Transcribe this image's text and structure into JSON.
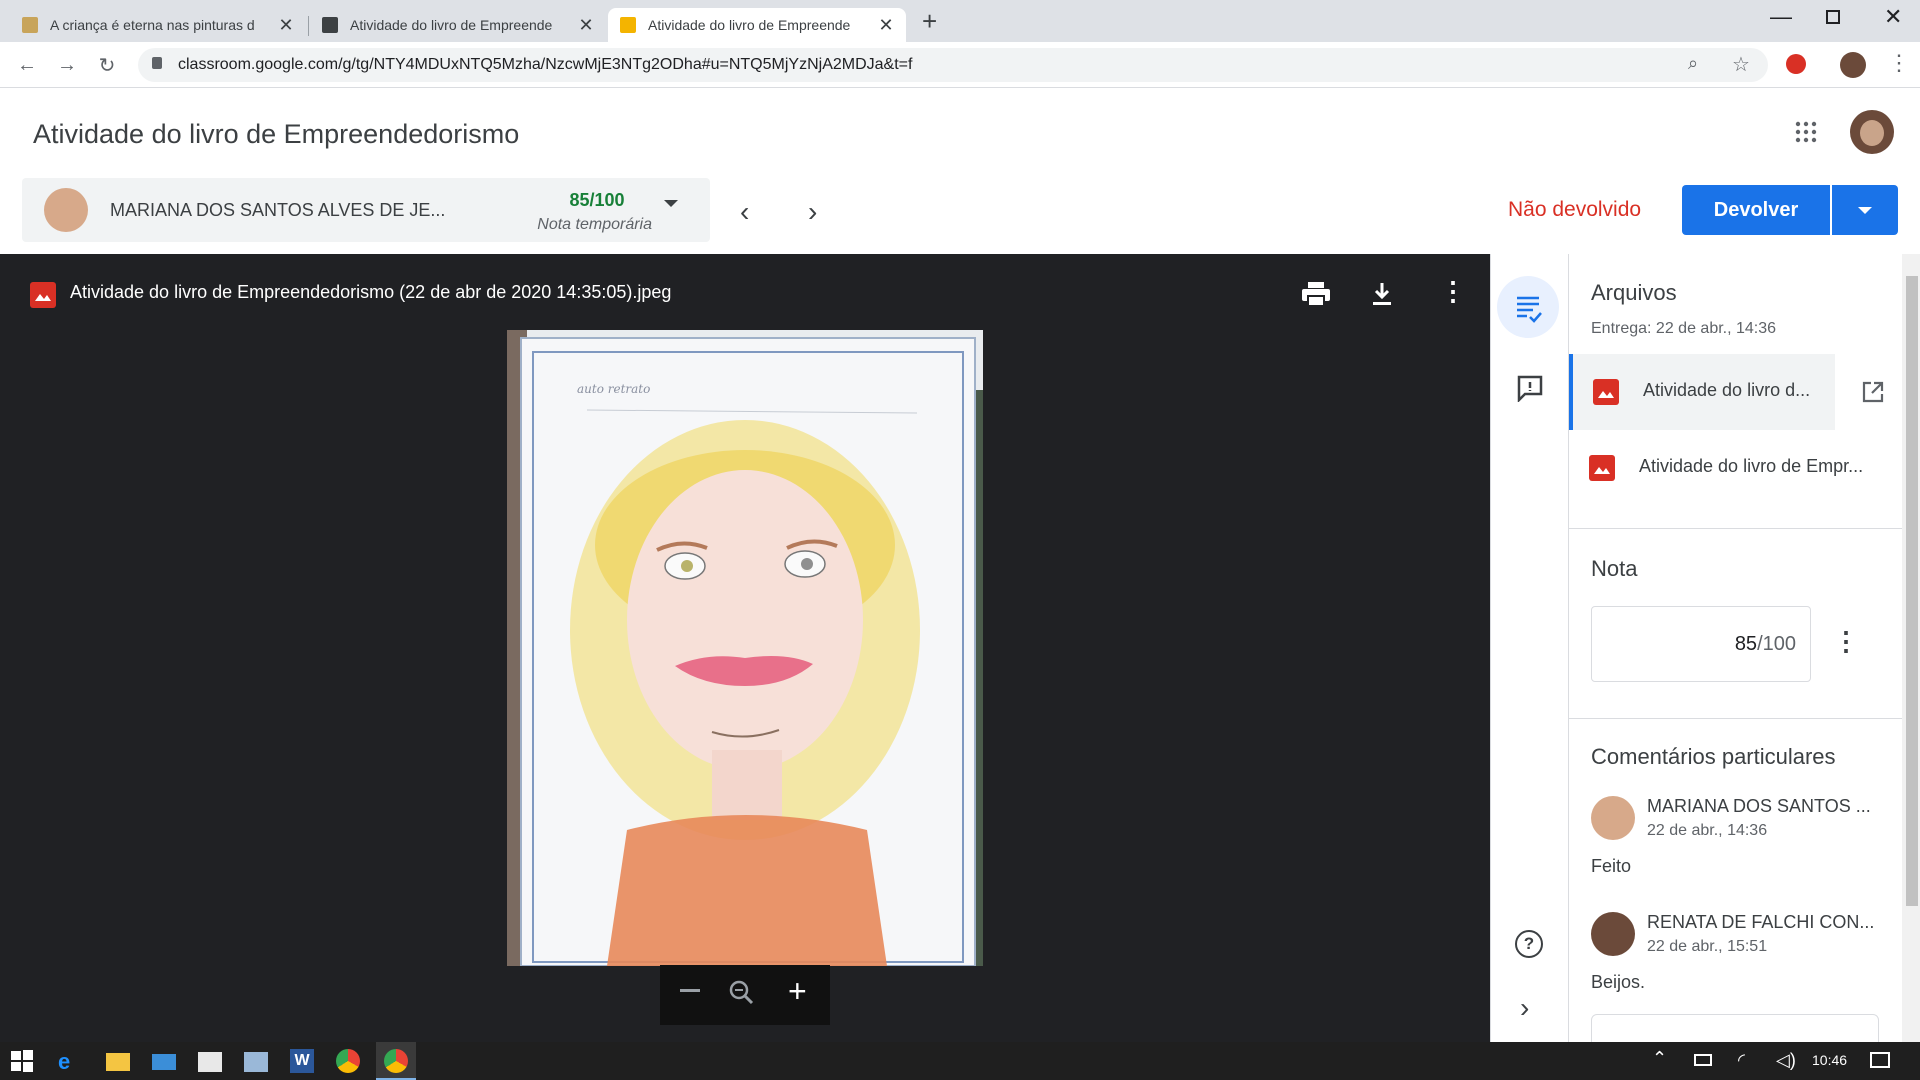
{
  "browser": {
    "tabs": [
      {
        "title": "A criança é eterna nas pinturas d",
        "active": false
      },
      {
        "title": "Atividade do livro de Empreende",
        "active": false
      },
      {
        "title": "Atividade do livro de Empreende",
        "active": true
      }
    ],
    "url": "classroom.google.com/g/tg/NTY4MDUxNTQ5Mzha/NzcwMjE3NTg2ODha#u=NTQ5MjYzNjA2MDJa&t=f"
  },
  "header": {
    "title": "Atividade do livro de Empreendedorismo"
  },
  "student": {
    "name": "MARIANA DOS SANTOS ALVES DE JE...",
    "grade": "85/100",
    "grade_note": "Nota temporária"
  },
  "status": {
    "label": "Não devolvido",
    "color": "#d93025"
  },
  "actions": {
    "return_label": "Devolver",
    "accent": "#1a73e8"
  },
  "viewer": {
    "file_title": "Atividade do livro de Empreendedorismo (22 de abr de 2020 14:35:05).jpeg",
    "drawing_caption": "auto retrato"
  },
  "side": {
    "files_heading": "Arquivos",
    "delivery": "Entrega: 22 de abr., 14:36",
    "files": [
      {
        "name": "Atividade do livro d...",
        "selected": true
      },
      {
        "name": "Atividade do livro de Empr...",
        "selected": false
      }
    ],
    "grade_heading": "Nota",
    "grade_value": "85",
    "grade_total": "/100",
    "comments_heading": "Comentários particulares",
    "comments": [
      {
        "author": "MARIANA DOS SANTOS ...",
        "time": "22 de abr., 14:36",
        "text": "Feito"
      },
      {
        "author": "RENATA DE FALCHI CON...",
        "time": "22 de abr., 15:51",
        "text": "Beijos."
      }
    ]
  },
  "taskbar": {
    "time": "10:46"
  }
}
